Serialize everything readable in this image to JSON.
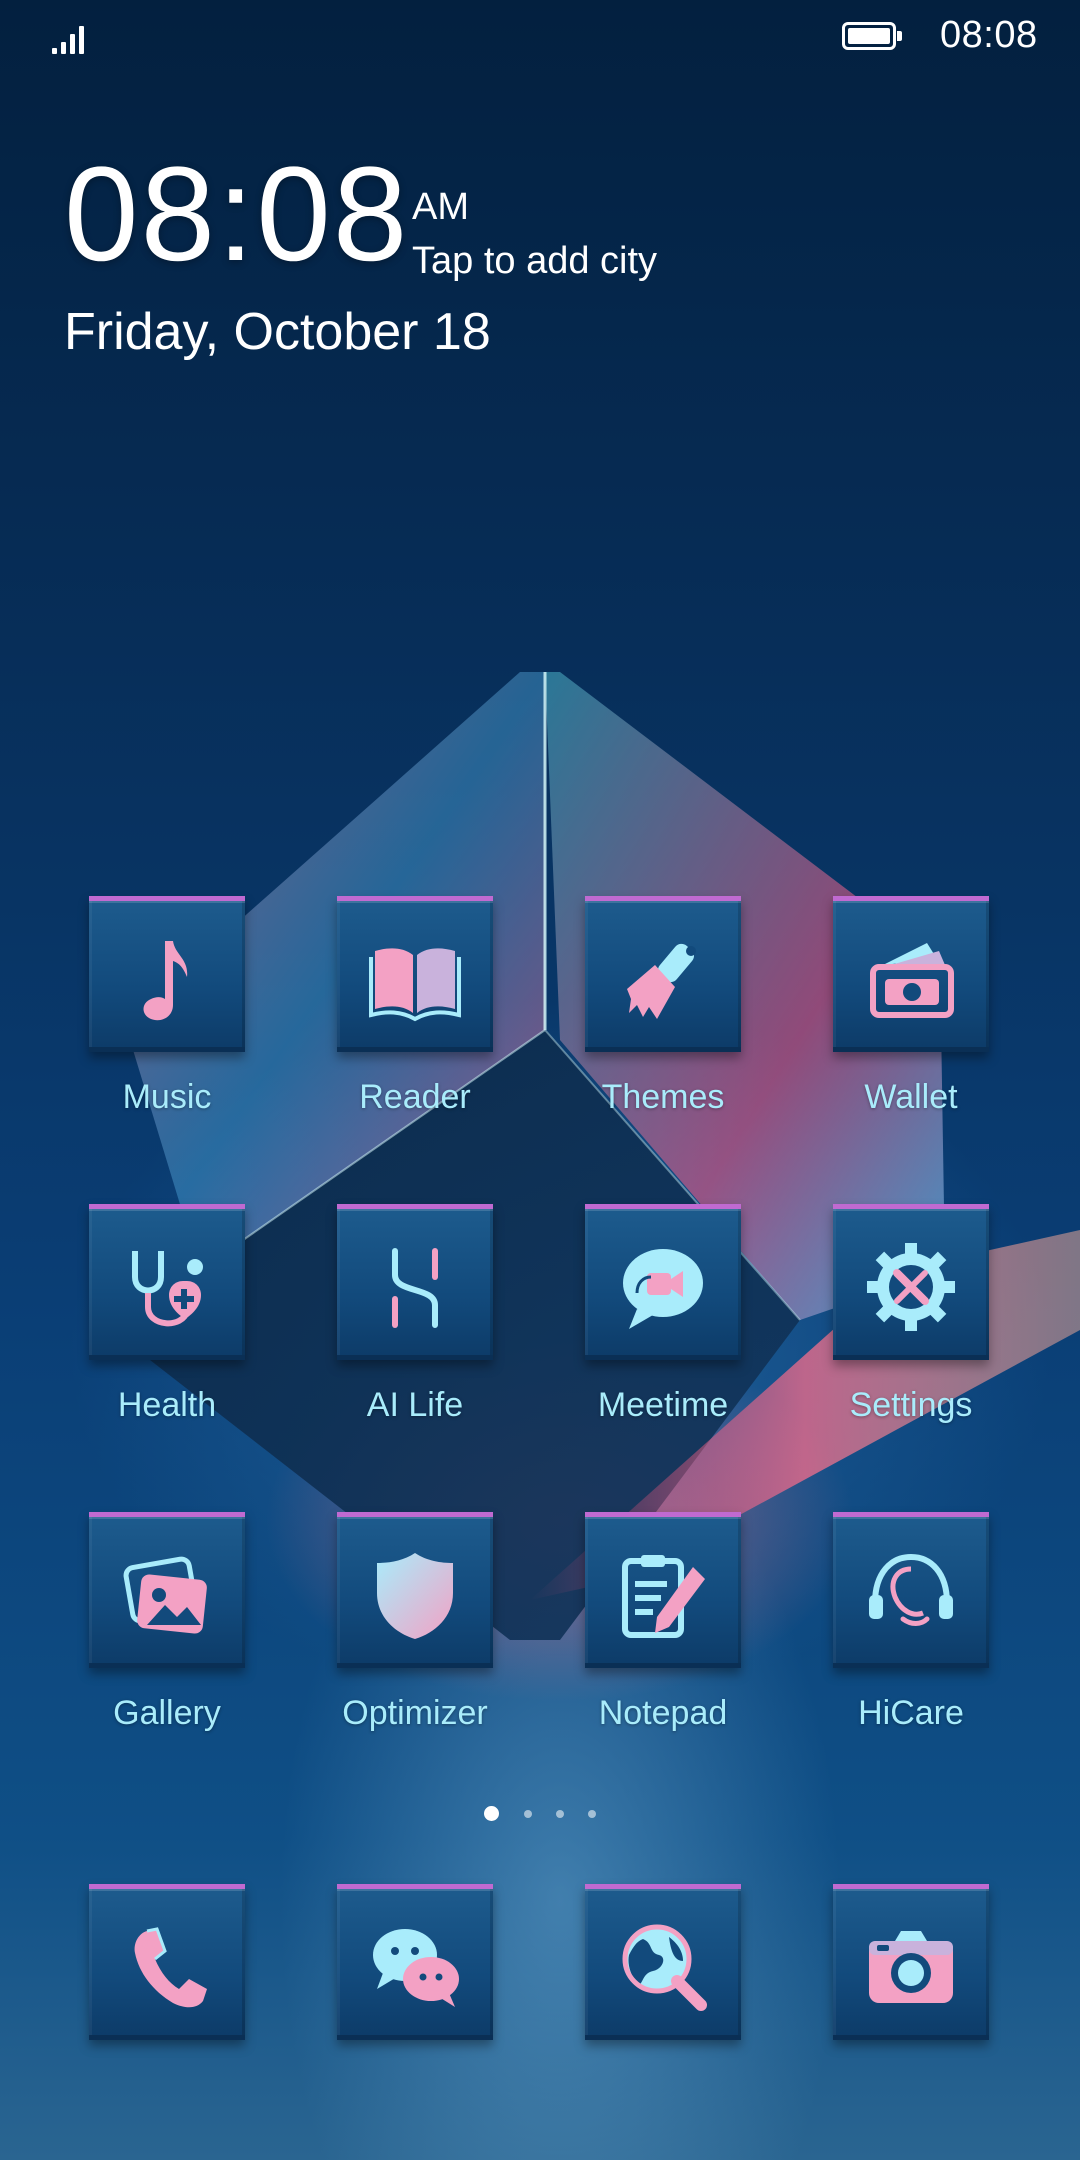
{
  "status_bar": {
    "time": "08:08",
    "battery_level": 1.0,
    "signal_icon": "signal-icon",
    "battery_icon": "battery-icon"
  },
  "clock_widget": {
    "time": "08:08",
    "ampm": "AM",
    "city_prompt": "Tap to add city",
    "date": "Friday, October 18"
  },
  "apps": [
    {
      "label": "Music",
      "icon": "music-note-icon"
    },
    {
      "label": "Reader",
      "icon": "book-icon"
    },
    {
      "label": "Themes",
      "icon": "paintbrush-icon"
    },
    {
      "label": "Wallet",
      "icon": "wallet-icon"
    },
    {
      "label": "Health",
      "icon": "stethoscope-icon"
    },
    {
      "label": "AI Life",
      "icon": "ai-life-icon"
    },
    {
      "label": "Meetime",
      "icon": "video-chat-icon"
    },
    {
      "label": "Settings",
      "icon": "gear-icon"
    },
    {
      "label": "Gallery",
      "icon": "gallery-icon"
    },
    {
      "label": "Optimizer",
      "icon": "shield-icon"
    },
    {
      "label": "Notepad",
      "icon": "notepad-icon"
    },
    {
      "label": "HiCare",
      "icon": "headset-icon"
    }
  ],
  "page_indicator": {
    "pages": 4,
    "current": 1
  },
  "dock": [
    {
      "icon": "phone-icon"
    },
    {
      "icon": "chat-bubbles-icon"
    },
    {
      "icon": "browser-icon"
    },
    {
      "icon": "camera-icon"
    }
  ],
  "colors": {
    "icon_pink": "#f3a1c4",
    "icon_cyan": "#a9ecfb",
    "tile_top_accent": "#c06ad1",
    "background": "#0a3e75"
  }
}
